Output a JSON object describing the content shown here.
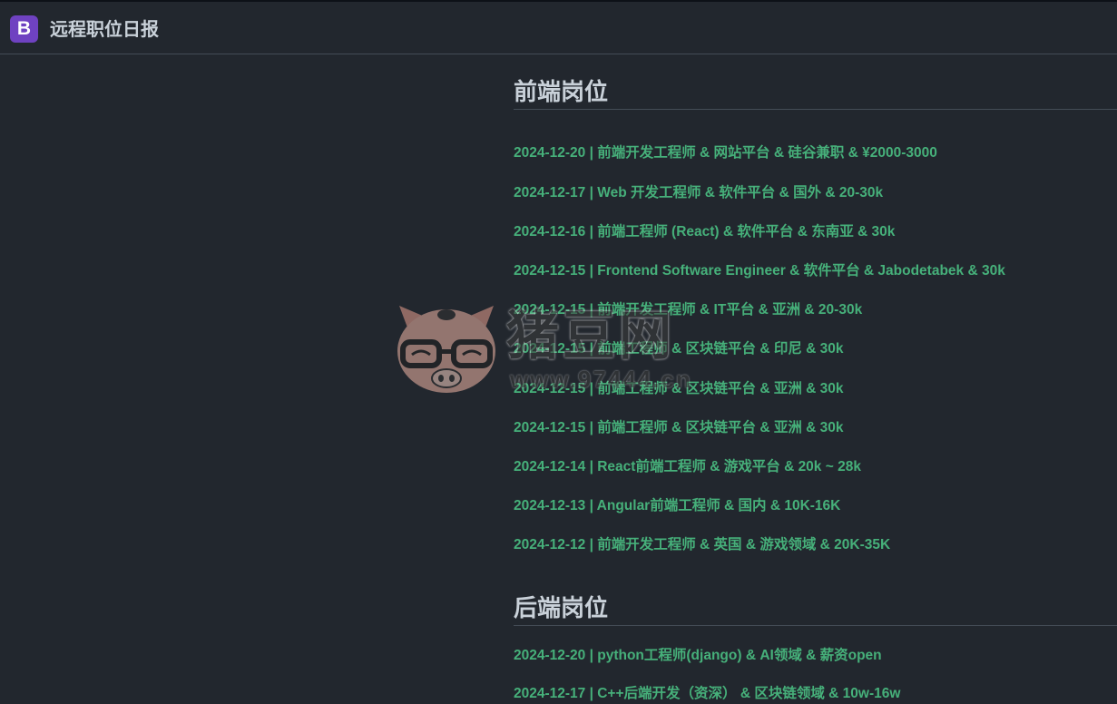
{
  "header": {
    "logo_letter": "B",
    "title": "远程职位日报"
  },
  "sections": [
    {
      "title": "前端岗位",
      "jobs": [
        "2024-12-20 | 前端开发工程师 & 网站平台 & 硅谷兼职 & ¥2000-3000",
        "2024-12-17 | Web 开发工程师 & 软件平台 & 国外 & 20-30k",
        "2024-12-16 | 前端工程师 (React) & 软件平台 & 东南亚 & 30k",
        "2024-12-15 | Frontend Software Engineer & 软件平台 & Jabodetabek & 30k",
        "2024-12-15 | 前端开发工程师 & IT平台 & 亚洲 & 20-30k",
        "2024-12-15 | 前端工程师 & 区块链平台 & 印尼 & 30k",
        "2024-12-15 | 前端工程师 & 区块链平台 & 亚洲 & 30k",
        "2024-12-15 | 前端工程师 & 区块链平台 & 亚洲 & 30k",
        "2024-12-14 | React前端工程师 & 游戏平台 & 20k ~ 28k",
        "2024-12-13 | Angular前端工程师 & 国内 & 10K-16K",
        "2024-12-12 | 前端开发工程师 & 英国 & 游戏领域 & 20K-35K"
      ]
    },
    {
      "title": "后端岗位",
      "jobs": [
        "2024-12-20 | python工程师(django) & AI领域 & 薪资open",
        "2024-12-17 | C++后端开发（资深） & 区块链领域 & 10w-16w"
      ]
    }
  ],
  "watermark": {
    "text": "猪豆网",
    "sub": "www.97444.cn"
  },
  "colors": {
    "background": "#22272e",
    "link": "#46b07a",
    "heading": "#c9d1d9",
    "brand": "#6f42c1"
  }
}
